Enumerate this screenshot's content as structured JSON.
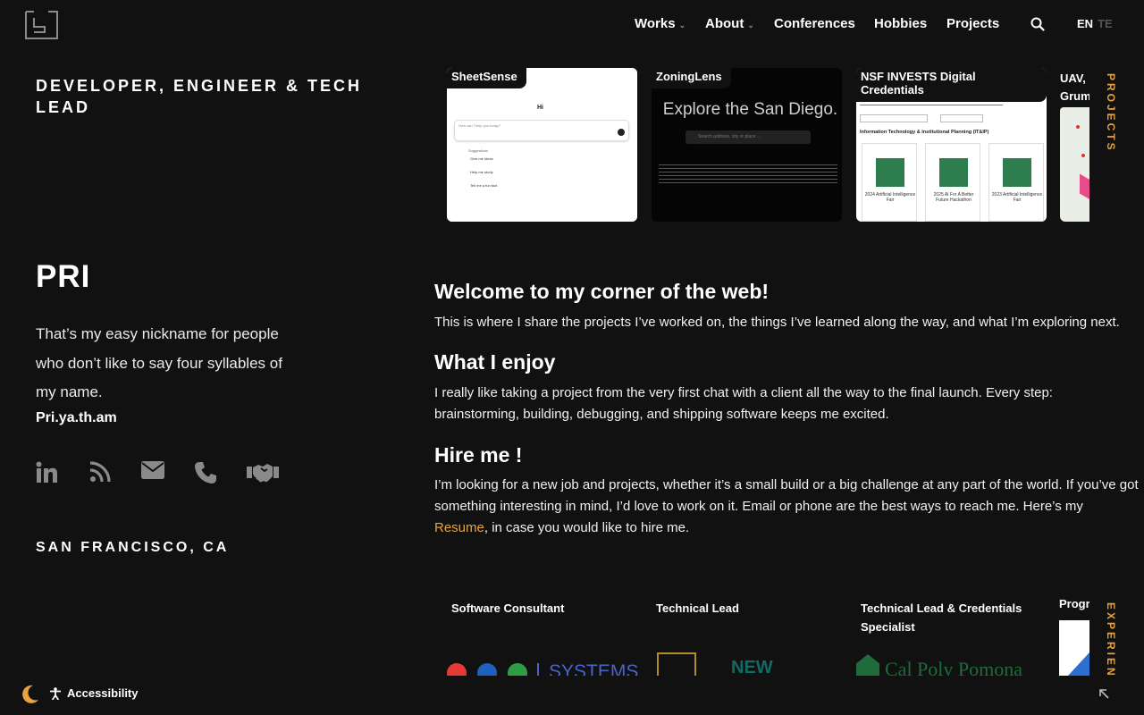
{
  "header": {
    "logo_icon": "logo-mark-icon",
    "nav": [
      {
        "label": "Works",
        "has_dropdown": true
      },
      {
        "label": "About",
        "has_dropdown": true
      },
      {
        "label": "Conferences",
        "has_dropdown": false
      },
      {
        "label": "Hobbies",
        "has_dropdown": false
      },
      {
        "label": "Projects",
        "has_dropdown": false
      }
    ],
    "search_icon": "search-icon",
    "lang_active": "EN",
    "lang_inactive": "TE"
  },
  "profile": {
    "role": "DEVELOPER, ENGINEER & TECH LEAD",
    "name": "PRI",
    "nickname_note": "That’s my easy nickname for people who don’t like to say four syllables of my name.",
    "pronunciation": "Pri.ya.th.am",
    "socials": [
      "linkedin-icon",
      "rss-icon",
      "email-icon",
      "phone-icon",
      "handshake-icon"
    ],
    "location": "SAN FRANCISCO, CA"
  },
  "projects": {
    "tab_label": "PROJECTS",
    "cards": [
      {
        "title": "SheetSense",
        "preview_text": [
          "Hi",
          "How can I help you today?",
          "Suggestions",
          "Give me ideas",
          "Help me study",
          "Tell me a fun fact"
        ]
      },
      {
        "title": "ZoningLens",
        "preview_text": [
          "Explore the San Diego.",
          "Search address, city or place ..."
        ]
      },
      {
        "title": "NSF INVESTS Digital Credentials",
        "preview_text": [
          "Information Technology & Institutional Planning (IT&IP)",
          "2024 Artificial Intelligence Fair",
          "2025 AI For A Better Future Hackathon",
          "2023 Artificial Intelligence Fair"
        ]
      },
      {
        "title": "UAV, Grum",
        "preview_text": []
      }
    ]
  },
  "content": {
    "welcome_heading": "Welcome to my corner of the web!",
    "welcome_text": "This is where I share the projects I’ve worked on, the things I’ve learned along the way, and what I’m exploring next.",
    "enjoy_heading": "What I enjoy",
    "enjoy_text": "I really like taking a project from the very first chat with a client all the way to the final launch. Every step: brainstorming, building, debugging, and shipping software keeps me excited.",
    "hire_heading": "Hire me !",
    "hire_text_before": "I’m looking for a new job and projects, whether it’s a small build or a big challenge at any part of the world. If you’ve got something interesting in mind, I’d love to work on it. Email or phone are the best ways to reach me. Here’s my ",
    "hire_link": "Resume",
    "hire_text_after": ", in case you would like to hire me."
  },
  "experience": {
    "tab_label": "EXPERIEN",
    "cards": [
      {
        "title": "Software Consultant",
        "logo_text": "SYSTEMS"
      },
      {
        "title": "Technical Lead",
        "logo_text": "NEW"
      },
      {
        "title": "Technical Lead & Credentials Specialist",
        "logo_text": "Cal Poly Pomona"
      },
      {
        "title": "Progr",
        "logo_text": ""
      }
    ]
  },
  "footer": {
    "theme_icon": "moon-icon",
    "accessibility_label": "Accessibility",
    "accessibility_icon": "accessibility-icon",
    "collapse_icon": "arrow-up-left-icon"
  },
  "colors": {
    "background": "#111111",
    "accent": "#e8a33d",
    "text": "#ffffff"
  }
}
